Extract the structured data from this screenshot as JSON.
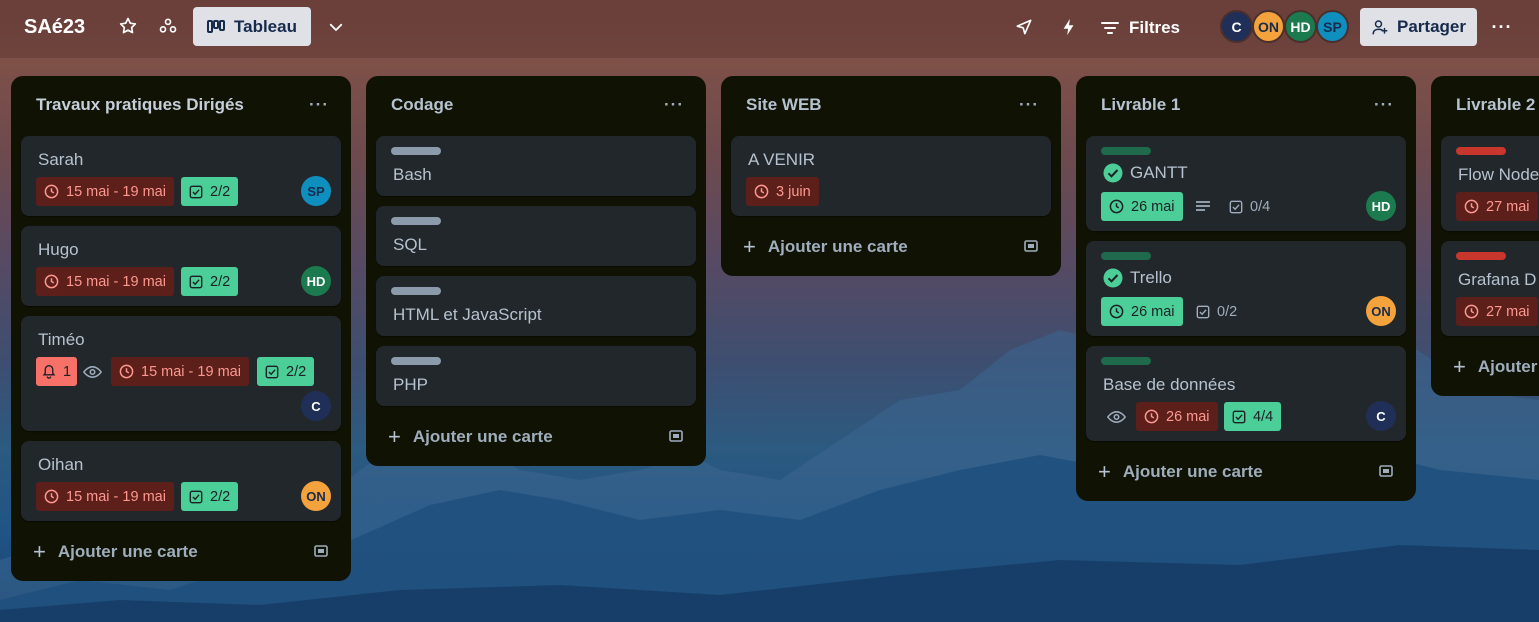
{
  "header": {
    "board_title": "SAé23",
    "view_label": "Tableau",
    "filters_label": "Filtres",
    "share_label": "Partager",
    "members": [
      {
        "initials": "C",
        "color": "#1f2f57",
        "text": "#ffffff"
      },
      {
        "initials": "ON",
        "color": "#f4a23c",
        "text": "#172b4d"
      },
      {
        "initials": "HD",
        "color": "#1b7a4e",
        "text": "#ffffff"
      },
      {
        "initials": "SP",
        "color": "#0f8fbd",
        "text": "#172b4d"
      }
    ]
  },
  "lists": [
    {
      "title": "Travaux pratiques Dirigés",
      "add_label": "Ajouter une carte",
      "cards": [
        {
          "title": "Sarah",
          "due": "15 mai - 19 mai",
          "checklist": "2/2",
          "member": "SP"
        },
        {
          "title": "Hugo",
          "due": "15 mai - 19 mai",
          "checklist": "2/2",
          "member": "HD"
        },
        {
          "title": "Timéo",
          "notifications": "1",
          "due": "15 mai - 19 mai",
          "checklist": "2/2",
          "member": "C"
        },
        {
          "title": "Oihan",
          "due": "15 mai - 19 mai",
          "checklist": "2/2",
          "member": "ON"
        }
      ]
    },
    {
      "title": "Codage",
      "add_label": "Ajouter une carte",
      "cards": [
        {
          "title": "Bash"
        },
        {
          "title": "SQL"
        },
        {
          "title": "HTML et JavaScript"
        },
        {
          "title": "PHP"
        }
      ]
    },
    {
      "title": "Site WEB",
      "add_label": "Ajouter une carte",
      "cards": [
        {
          "title": "A VENIR",
          "due": "3 juin"
        }
      ]
    },
    {
      "title": "Livrable 1",
      "add_label": "Ajouter une carte",
      "cards": [
        {
          "title": "GANTT",
          "due": "26 mai",
          "checklist": "0/4",
          "member": "HD"
        },
        {
          "title": "Trello",
          "due": "26 mai",
          "checklist": "0/2",
          "member": "ON"
        },
        {
          "title": "Base de données",
          "due": "26 mai",
          "checklist": "4/4",
          "member": "C"
        }
      ]
    },
    {
      "title": "Livrable 2",
      "add_label": "Ajouter une carte",
      "cards": [
        {
          "title": "Flow Node",
          "due": "27 mai"
        },
        {
          "title": "Grafana D",
          "due": "27 mai"
        }
      ]
    }
  ],
  "colors": {
    "list_bg": "#101204",
    "card_bg": "#22272b",
    "due_overdue_bg": "#5d1f1a",
    "due_done_bg": "#4bce97",
    "label_grey": "#8c9bab",
    "label_green": "#1f6a4c",
    "label_red": "#c9372c"
  }
}
